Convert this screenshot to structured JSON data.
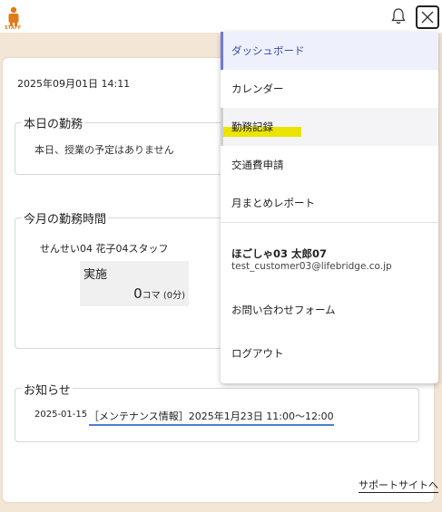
{
  "header": {
    "logo_text": "STAFF",
    "icons": [
      "bell-icon",
      "close-icon"
    ]
  },
  "main": {
    "datetime": "2025年09月01日 14:11",
    "today_section": {
      "title": "本日の勤務",
      "message": "本日、授業の予定はありません"
    },
    "month_section": {
      "title": "今月の勤務時間",
      "staff": "せんせい04 花子04スタッフ",
      "jisshi_label": "実施",
      "jisshi_count": "0",
      "jisshi_unit": "コマ",
      "jisshi_minutes": "(0分)"
    },
    "news_section": {
      "title": "お知らせ",
      "items": [
        {
          "date": "2025-01-15",
          "title": "［メンテナンス情報］2025年1月23日 11:00～12:00"
        }
      ]
    },
    "support_link": "サポートサイトへ"
  },
  "menu": {
    "items": [
      {
        "label": "ダッシュボード"
      },
      {
        "label": "カレンダー"
      },
      {
        "label": "勤務記録"
      },
      {
        "label": "交通費申請"
      },
      {
        "label": "月まとめレポート"
      }
    ],
    "user": {
      "name": "ほごしゃ03 太郎07",
      "email": "test_customer03@lifebridge.co.jp"
    },
    "contact": "お問い合わせフォーム",
    "logout": "ログアウト"
  },
  "colors": {
    "page_bg": "#f4e6d6",
    "logo": "#e07b1a",
    "menu_active_bg": "#eef0fb",
    "menu_active_text": "#3c4aa8",
    "highlight": "#f6ee00",
    "link_underline": "#4a7fd4"
  }
}
